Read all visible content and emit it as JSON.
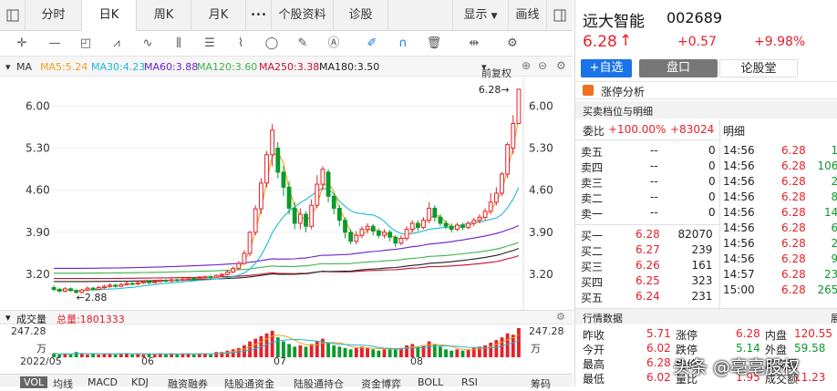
{
  "tabs": {
    "minute": "分时",
    "daily": "日K",
    "weekly": "周K",
    "monthly": "月K",
    "more": "•••",
    "profile": "个股资料",
    "diagnose": "诊股",
    "display": "显示",
    "drawline": "画线"
  },
  "ma_bar": {
    "title": "MA",
    "ma5": "MA5:5.24",
    "ma30": "MA30:4.23",
    "ma60": "MA60:3.88",
    "ma120": "MA120:3.60",
    "ma250": "MA250:3.38",
    "ma180": "MA180:3.50",
    "adjust": "前复权",
    "colors": {
      "ma5": "#f0a020",
      "ma30": "#20b8d8",
      "ma60": "#6a1fd0",
      "ma120": "#3cb64a",
      "ma250": "#c8102e",
      "ma180": "#222222"
    }
  },
  "chart_data": {
    "type": "candlestick",
    "title": "",
    "yticks": [
      "6.00",
      "5.30",
      "4.60",
      "3.90",
      "3.20"
    ],
    "ylim": [
      2.7,
      6.4
    ],
    "xticks": [
      "2022/05",
      "06",
      "07",
      "08"
    ],
    "high_label": "6.28→",
    "low_label": "←2.88",
    "candles": [
      [
        2.98,
        2.95,
        2.92,
        3.02
      ],
      [
        2.95,
        2.92,
        2.9,
        2.98
      ],
      [
        2.92,
        2.96,
        2.9,
        2.99
      ],
      [
        2.96,
        2.93,
        2.91,
        2.98
      ],
      [
        2.93,
        2.9,
        2.88,
        2.95
      ],
      [
        2.9,
        2.94,
        2.88,
        2.96
      ],
      [
        2.94,
        2.97,
        2.92,
        3.0
      ],
      [
        2.97,
        2.95,
        2.93,
        2.99
      ],
      [
        2.95,
        2.98,
        2.94,
        3.01
      ],
      [
        2.98,
        3.0,
        2.96,
        3.03
      ],
      [
        3.0,
        3.02,
        2.98,
        3.05
      ],
      [
        3.02,
        3.0,
        2.98,
        3.04
      ],
      [
        3.0,
        3.03,
        2.99,
        3.06
      ],
      [
        3.03,
        3.05,
        3.01,
        3.08
      ],
      [
        3.05,
        3.04,
        3.02,
        3.07
      ],
      [
        3.04,
        3.06,
        3.02,
        3.09
      ],
      [
        3.06,
        3.08,
        3.04,
        3.1
      ],
      [
        3.08,
        3.06,
        3.04,
        3.1
      ],
      [
        3.06,
        3.08,
        3.05,
        3.11
      ],
      [
        3.08,
        3.1,
        3.06,
        3.12
      ],
      [
        3.1,
        3.09,
        3.07,
        3.12
      ],
      [
        3.09,
        3.11,
        3.07,
        3.13
      ],
      [
        3.11,
        3.1,
        3.08,
        3.13
      ],
      [
        3.1,
        3.12,
        3.09,
        3.14
      ],
      [
        3.12,
        3.14,
        3.1,
        3.16
      ],
      [
        3.14,
        3.12,
        3.1,
        3.16
      ],
      [
        3.12,
        3.14,
        3.11,
        3.17
      ],
      [
        3.14,
        3.16,
        3.12,
        3.18
      ],
      [
        3.16,
        3.15,
        3.13,
        3.19
      ],
      [
        3.15,
        3.18,
        3.14,
        3.2
      ],
      [
        3.18,
        3.2,
        3.16,
        3.22
      ],
      [
        3.2,
        3.24,
        3.18,
        3.27
      ],
      [
        3.24,
        3.3,
        3.22,
        3.33
      ],
      [
        3.3,
        3.38,
        3.28,
        3.42
      ],
      [
        3.38,
        3.55,
        3.36,
        3.6
      ],
      [
        3.55,
        3.9,
        3.5,
        3.92
      ],
      [
        3.9,
        4.29,
        3.85,
        4.35
      ],
      [
        4.29,
        4.72,
        4.2,
        4.8
      ],
      [
        4.72,
        5.19,
        4.65,
        5.25
      ],
      [
        5.19,
        5.6,
        5.0,
        5.7
      ],
      [
        5.3,
        4.9,
        4.8,
        5.4
      ],
      [
        4.9,
        4.65,
        4.5,
        5.0
      ],
      [
        4.65,
        4.3,
        4.2,
        4.75
      ],
      [
        4.3,
        4.05,
        3.95,
        4.4
      ],
      [
        4.05,
        4.2,
        3.95,
        4.3
      ],
      [
        4.2,
        4.0,
        3.9,
        4.25
      ],
      [
        4.0,
        4.35,
        3.95,
        4.45
      ],
      [
        4.35,
        4.7,
        4.3,
        4.85
      ],
      [
        4.7,
        4.95,
        4.6,
        5.0
      ],
      [
        4.9,
        4.5,
        4.4,
        4.95
      ],
      [
        4.5,
        4.3,
        4.2,
        4.55
      ],
      [
        4.3,
        4.1,
        4.0,
        4.35
      ],
      [
        4.1,
        3.9,
        3.8,
        4.15
      ],
      [
        3.9,
        3.75,
        3.7,
        3.95
      ],
      [
        3.75,
        3.85,
        3.7,
        3.92
      ],
      [
        3.85,
        3.95,
        3.8,
        4.0
      ],
      [
        3.95,
        4.0,
        3.88,
        4.05
      ],
      [
        4.0,
        3.92,
        3.85,
        4.04
      ],
      [
        3.92,
        3.85,
        3.8,
        3.96
      ],
      [
        3.85,
        3.9,
        3.8,
        3.95
      ],
      [
        3.9,
        3.82,
        3.75,
        3.94
      ],
      [
        3.82,
        3.72,
        3.65,
        3.85
      ],
      [
        3.72,
        3.8,
        3.68,
        3.85
      ],
      [
        3.8,
        3.95,
        3.76,
        4.0
      ],
      [
        3.95,
        4.05,
        3.9,
        4.1
      ],
      [
        4.05,
        3.98,
        3.92,
        4.1
      ],
      [
        3.98,
        4.1,
        3.95,
        4.15
      ],
      [
        4.1,
        4.3,
        4.05,
        4.4
      ],
      [
        4.3,
        4.15,
        4.08,
        4.35
      ],
      [
        4.15,
        4.05,
        4.0,
        4.2
      ],
      [
        4.05,
        4.0,
        3.95,
        4.1
      ],
      [
        4.0,
        3.95,
        3.9,
        4.05
      ],
      [
        3.95,
        4.02,
        3.92,
        4.06
      ],
      [
        4.02,
        3.98,
        3.94,
        4.06
      ],
      [
        3.98,
        4.05,
        3.95,
        4.08
      ],
      [
        4.05,
        4.1,
        4.0,
        4.14
      ],
      [
        4.1,
        4.15,
        4.05,
        4.2
      ],
      [
        4.15,
        4.25,
        4.1,
        4.3
      ],
      [
        4.25,
        4.4,
        4.2,
        4.55
      ],
      [
        4.4,
        4.55,
        4.35,
        4.65
      ],
      [
        4.55,
        4.87,
        4.5,
        4.9
      ],
      [
        4.87,
        5.36,
        4.8,
        5.4
      ],
      [
        5.3,
        5.71,
        5.2,
        5.85
      ],
      [
        5.71,
        6.28,
        5.71,
        6.28
      ]
    ],
    "volume_ticks": [
      "247.28",
      "万"
    ],
    "volumes": [
      3,
      2,
      3,
      2,
      4,
      3,
      2,
      3,
      2,
      3,
      3,
      2,
      3,
      3,
      2,
      3,
      2,
      3,
      2,
      3,
      2,
      3,
      2,
      3,
      3,
      2,
      3,
      3,
      2,
      4,
      4,
      5,
      6,
      7,
      9,
      12,
      14,
      16,
      18,
      20,
      15,
      12,
      10,
      8,
      9,
      8,
      10,
      12,
      14,
      11,
      9,
      8,
      7,
      6,
      7,
      8,
      7,
      6,
      5,
      6,
      7,
      6,
      7,
      9,
      10,
      8,
      9,
      12,
      10,
      8,
      6,
      5,
      6,
      5,
      6,
      7,
      8,
      9,
      11,
      13,
      15,
      18,
      17,
      22
    ]
  },
  "vol_bar": {
    "title": "成交量",
    "total_label": "总量:1801333"
  },
  "ind_tabs": [
    "VOL",
    "均线",
    "MACD",
    "KDJ",
    "融资融券",
    "陆股通资金",
    "陆股通持仓",
    "资金博弈",
    "BOLL",
    "RSI",
    "筹码"
  ],
  "stock": {
    "name": "远大智能",
    "code": "002689",
    "price": "6.28",
    "arrow": "↑",
    "change": "+0.57",
    "pct": "+9.98%"
  },
  "actions": {
    "add": "+自选",
    "board": "盘口",
    "forum": "论股堂"
  },
  "limit_analysis": "涨停分析",
  "order_header": "买卖档位与明细",
  "weibi": {
    "label": "委比",
    "pct": "+100.00%",
    "diff": "+83024"
  },
  "detail_label": "明细",
  "asks": [
    {
      "label": "卖五",
      "price": "--",
      "vol": "0"
    },
    {
      "label": "卖四",
      "price": "--",
      "vol": "0"
    },
    {
      "label": "卖三",
      "price": "--",
      "vol": "0"
    },
    {
      "label": "卖二",
      "price": "--",
      "vol": "0"
    },
    {
      "label": "卖一",
      "price": "--",
      "vol": "0"
    }
  ],
  "bids": [
    {
      "label": "买一",
      "price": "6.28",
      "vol": "82070"
    },
    {
      "label": "买二",
      "price": "6.27",
      "vol": "239"
    },
    {
      "label": "买三",
      "price": "6.26",
      "vol": "161"
    },
    {
      "label": "买四",
      "price": "6.25",
      "vol": "323"
    },
    {
      "label": "买五",
      "price": "6.24",
      "vol": "231"
    }
  ],
  "ticks": [
    {
      "time": "14:56",
      "price": "6.28",
      "vol": "1"
    },
    {
      "time": "14:56",
      "price": "6.28",
      "vol": "106"
    },
    {
      "time": "14:56",
      "price": "6.28",
      "vol": "2"
    },
    {
      "time": "14:56",
      "price": "6.28",
      "vol": "8"
    },
    {
      "time": "14:56",
      "price": "6.28",
      "vol": "14"
    },
    {
      "time": "14:56",
      "price": "6.28",
      "vol": "6"
    },
    {
      "time": "14:56",
      "price": "6.28",
      "vol": "2"
    },
    {
      "time": "14:56",
      "price": "6.28",
      "vol": "9"
    },
    {
      "time": "14:57",
      "price": "6.28",
      "vol": "23"
    },
    {
      "time": "15:00",
      "price": "6.28",
      "vol": "265"
    }
  ],
  "quote_header": "行情数据",
  "quote_header_right": "展",
  "quotes": [
    {
      "l1": "昨收",
      "v1": "5.71",
      "l2": "涨停",
      "v2": "6.28",
      "l3": "内盘",
      "v3": "120.55"
    },
    {
      "l1": "今开",
      "v1": "6.02",
      "l2": "跌停",
      "v2": "5.14",
      "l3": "外盘",
      "v3": "59.58"
    },
    {
      "l1": "最高",
      "v1": "6.28",
      "l2": "均价",
      "v2": "",
      "l3": "成交量",
      "v3": ""
    },
    {
      "l1": "最低",
      "v1": "6.02",
      "l2": "量比",
      "v2": "1.95",
      "l3": "成交额",
      "v3": "11.23"
    }
  ],
  "watermark": "头条 @亳亳股权"
}
